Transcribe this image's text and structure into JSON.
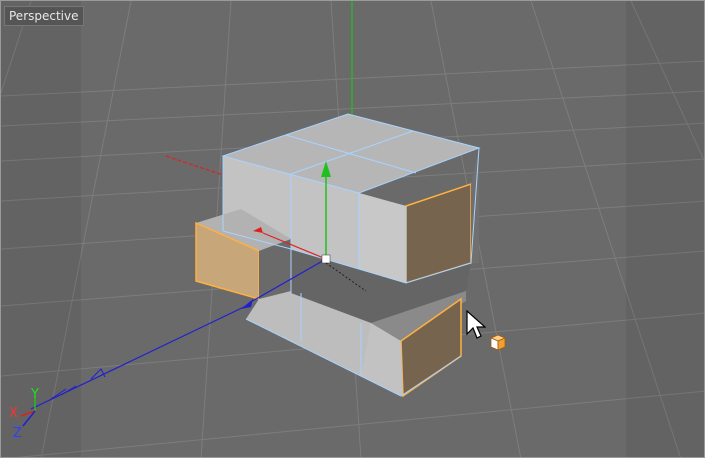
{
  "viewport": {
    "label": "Perspective"
  },
  "axis_gizmo": {
    "x_label": "X",
    "y_label": "Y",
    "z_label": "Z"
  },
  "colors": {
    "background": "#6a6a6a",
    "grid": "#7d7d7d",
    "face_top": "#b5b5b5",
    "face_front": "#c4c4c4",
    "face_side": "#6c6c6c",
    "selected_face": "#7a6548",
    "selected_face_light": "#c8a880",
    "selection_outline": "#ffb040",
    "wireframe": "#a9d3ff",
    "axis_x": "#e02020",
    "axis_y": "#20c020",
    "axis_z": "#2020d0"
  },
  "icons": {
    "cursor": "mouse-pointer-icon",
    "tool": "cube-tool-icon"
  }
}
